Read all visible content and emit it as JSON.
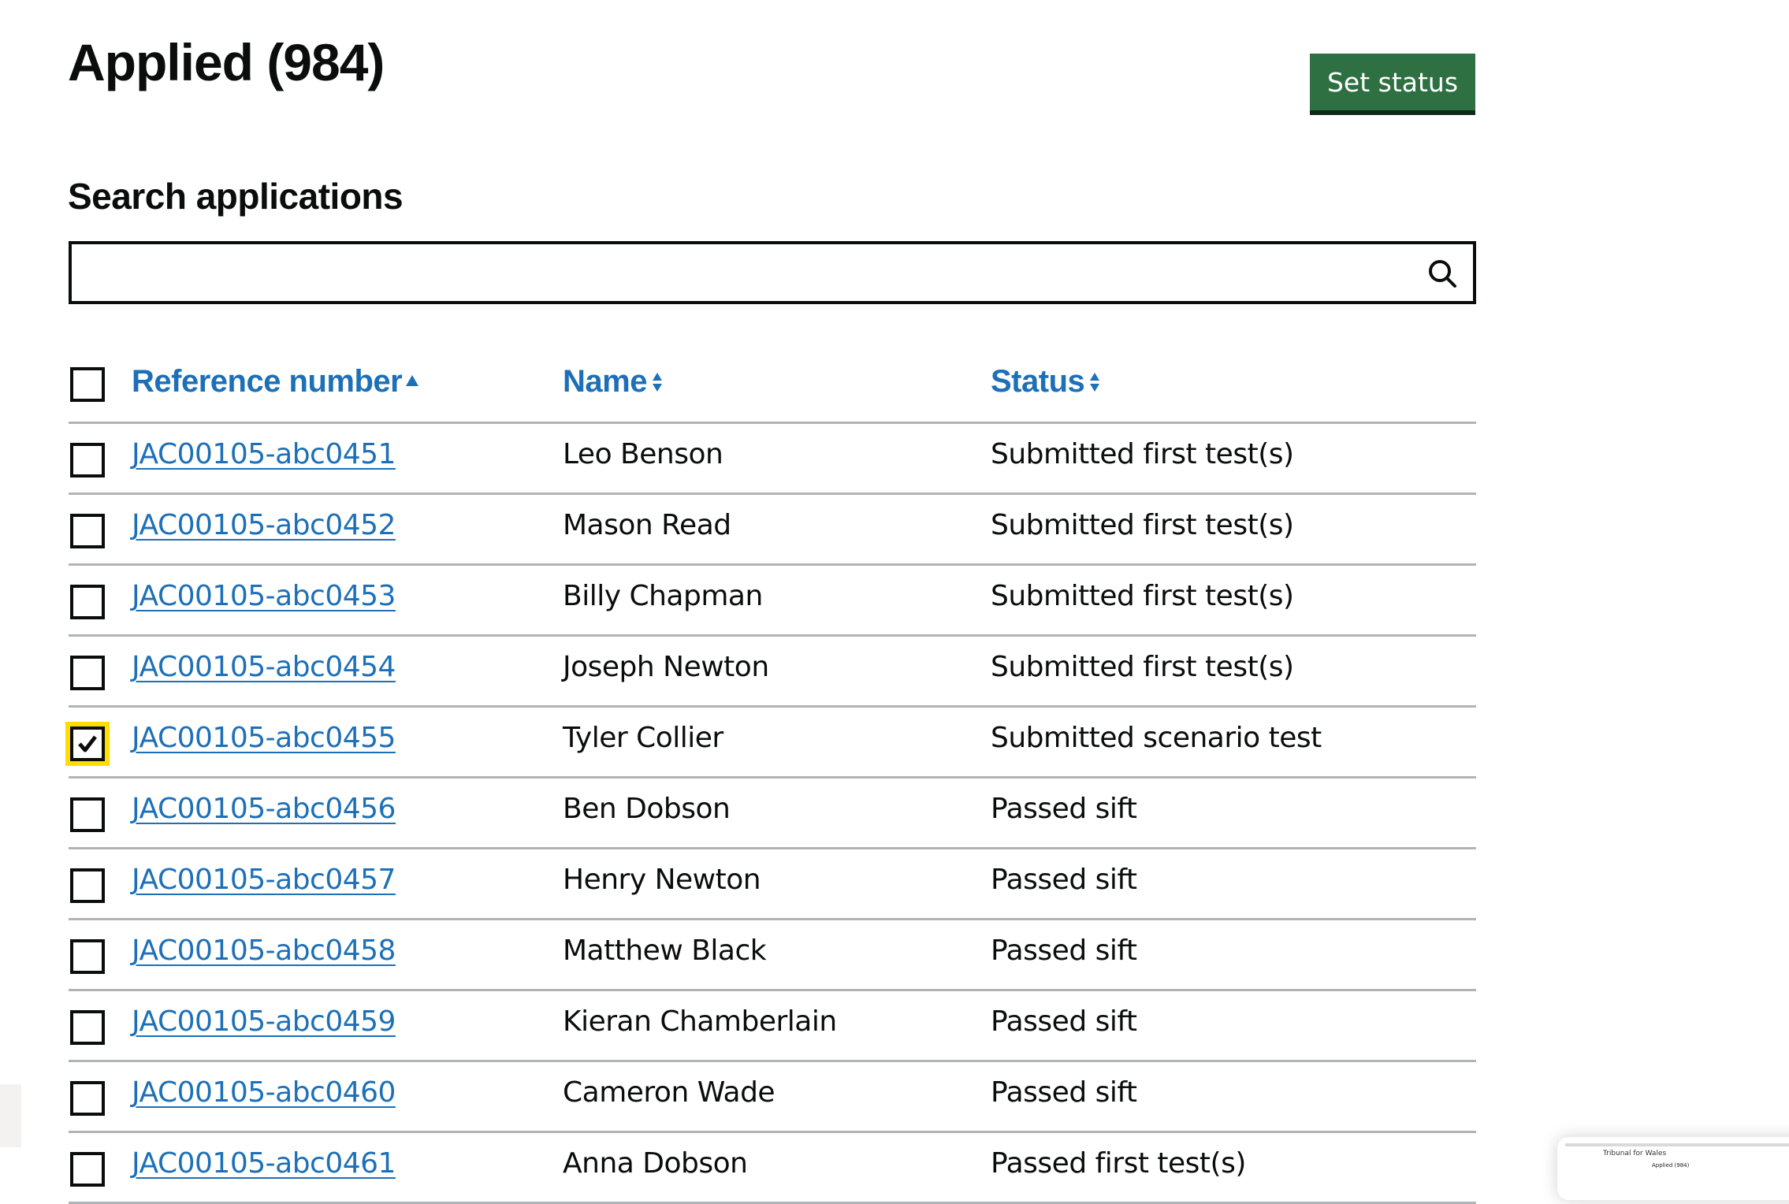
{
  "header": {
    "title": "Applied (984)",
    "set_status_label": "Set status"
  },
  "search": {
    "label": "Search applications",
    "value": "",
    "placeholder": "",
    "icon": "search-icon"
  },
  "table": {
    "columns": [
      {
        "label": "Reference number",
        "sort": "ascending",
        "sort_icon": "sort-ascending-icon"
      },
      {
        "label": "Name",
        "sort": "none",
        "sort_icon": "sort-both-icon"
      },
      {
        "label": "Status",
        "sort": "none",
        "sort_icon": "sort-both-icon"
      }
    ],
    "select_all_checked": false,
    "rows": [
      {
        "ref": "JAC00105-abc0451",
        "name": "Leo Benson",
        "status": "Submitted first test(s)",
        "checked": false
      },
      {
        "ref": "JAC00105-abc0452",
        "name": "Mason Read",
        "status": "Submitted first test(s)",
        "checked": false
      },
      {
        "ref": "JAC00105-abc0453",
        "name": "Billy Chapman",
        "status": "Submitted first test(s)",
        "checked": false
      },
      {
        "ref": "JAC00105-abc0454",
        "name": "Joseph Newton",
        "status": "Submitted first test(s)",
        "checked": false
      },
      {
        "ref": "JAC00105-abc0455",
        "name": "Tyler Collier",
        "status": "Submitted scenario test",
        "checked": true
      },
      {
        "ref": "JAC00105-abc0456",
        "name": "Ben Dobson",
        "status": "Passed sift",
        "checked": false
      },
      {
        "ref": "JAC00105-abc0457",
        "name": "Henry Newton",
        "status": "Passed sift",
        "checked": false
      },
      {
        "ref": "JAC00105-abc0458",
        "name": "Matthew Black",
        "status": "Passed sift",
        "checked": false
      },
      {
        "ref": "JAC00105-abc0459",
        "name": "Kieran Chamberlain",
        "status": "Passed sift",
        "checked": false
      },
      {
        "ref": "JAC00105-abc0460",
        "name": "Cameron Wade",
        "status": "Passed sift",
        "checked": false
      },
      {
        "ref": "JAC00105-abc0461",
        "name": "Anna Dobson",
        "status": "Passed first test(s)",
        "checked": false
      }
    ]
  },
  "thumbnail": {
    "title": "Tribunal for Wales",
    "subtitle": "Applied (984)"
  },
  "colors": {
    "link": "#1d70b8",
    "button": "#2f7042",
    "focus": "#ffdd00",
    "border": "#b1b4b6",
    "text": "#0b0c0c"
  }
}
